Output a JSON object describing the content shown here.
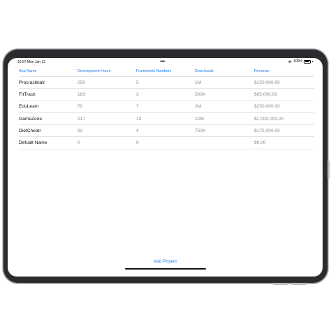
{
  "status_bar": {
    "time": "10:57",
    "date": "Mon Jan 13",
    "battery": "100%"
  },
  "table": {
    "headers": [
      "App Name",
      "Development Hours",
      "Framework Numbers",
      "Downloads",
      "Revenue"
    ],
    "rows": [
      [
        "Procrastinatr",
        "250",
        "5",
        "1M",
        "$150,000,00"
      ],
      [
        "FitTrack",
        "183",
        "3",
        "500K",
        "$95,000,00"
      ],
      [
        "EduLearn",
        "70",
        "7",
        "2M",
        "$250,000,00"
      ],
      [
        "GameZone",
        "217",
        "10",
        "10M",
        "$1,000,000,00"
      ],
      [
        "DietCheatr",
        "92",
        "4",
        "750K",
        "$175,000,00"
      ],
      [
        "Defualt Name",
        "0",
        "0",
        "",
        "$0,00"
      ]
    ]
  },
  "footer": {
    "add_project_label": "Add Project"
  },
  "colors": {
    "accent": "#1a7cf2",
    "secondary_text": "#8e8e93",
    "bezel": "#2b2b2d"
  }
}
